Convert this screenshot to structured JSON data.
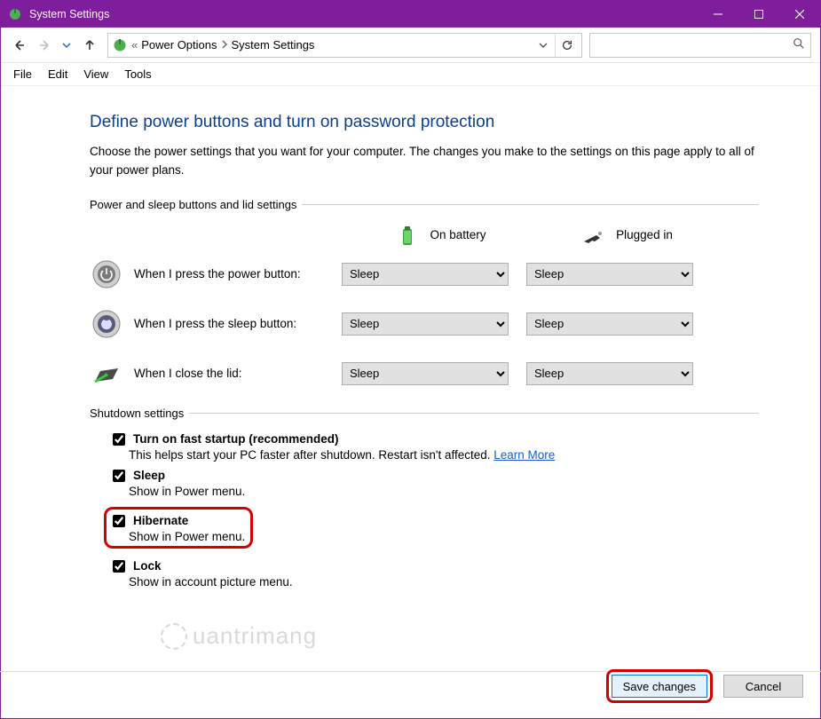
{
  "window": {
    "title": "System Settings"
  },
  "breadcrumb": {
    "item1": "Power Options",
    "item2": "System Settings"
  },
  "menu": {
    "file": "File",
    "edit": "Edit",
    "view": "View",
    "tools": "Tools"
  },
  "page": {
    "heading": "Define power buttons and turn on password protection",
    "description": "Choose the power settings that you want for your computer. The changes you make to the settings on this page apply to all of your power plans.",
    "section1": "Power and sleep buttons and lid settings",
    "col_battery": "On battery",
    "col_plugged": "Plugged in",
    "rows": [
      {
        "label": "When I press the power button:",
        "battery": "Sleep",
        "plugged": "Sleep"
      },
      {
        "label": "When I press the sleep button:",
        "battery": "Sleep",
        "plugged": "Sleep"
      },
      {
        "label": "When I close the lid:",
        "battery": "Sleep",
        "plugged": "Sleep"
      }
    ],
    "section2": "Shutdown settings",
    "shutdown": {
      "fast_startup": {
        "checked": true,
        "label": "Turn on fast startup (recommended)",
        "desc": "This helps start your PC faster after shutdown. Restart isn't affected. ",
        "link": "Learn More"
      },
      "sleep": {
        "checked": true,
        "label": "Sleep",
        "desc": "Show in Power menu."
      },
      "hibernate": {
        "checked": true,
        "label": "Hibernate",
        "desc": "Show in Power menu."
      },
      "lock": {
        "checked": true,
        "label": "Lock",
        "desc": "Show in account picture menu."
      }
    },
    "buttons": {
      "save": "Save changes",
      "cancel": "Cancel"
    }
  },
  "watermark": "uantrimang"
}
